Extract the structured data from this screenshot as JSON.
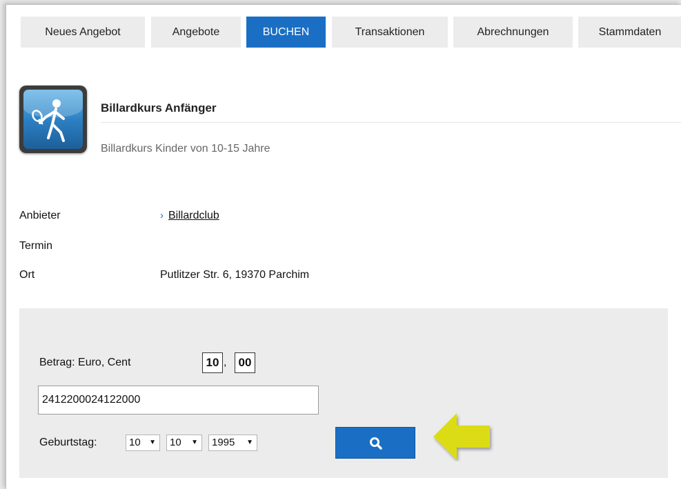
{
  "nav": {
    "tabs": [
      {
        "label": "Neues Angebot"
      },
      {
        "label": "Angebote"
      },
      {
        "label": "BUCHEN"
      },
      {
        "label": "Transaktionen"
      },
      {
        "label": "Abrechnungen"
      },
      {
        "label": "Stammdaten"
      }
    ],
    "active_tab": "BUCHEN"
  },
  "course": {
    "icon": "person-tennis-icon",
    "title": "Billardkurs Anfänger",
    "subtitle": "Billardkurs Kinder von 10-15 Jahre"
  },
  "details": {
    "anbieter_label": "Anbieter",
    "anbieter_link_icon": "chevron-right-icon",
    "anbieter_value": "Billardclub",
    "termin_label": "Termin",
    "termin_value": "",
    "ort_label": "Ort",
    "ort_value": "Putlitzer Str. 6, 19370 Parchim"
  },
  "booking": {
    "amount_label": "Betrag:  Euro, Cent",
    "euro_value": "10",
    "cent_value": "00",
    "comma": ",",
    "card_number": "2412200024122000",
    "birthday_label": "Geburtstag:",
    "day_value": "10",
    "month_value": "10",
    "year_value": "1995",
    "search_button_icon": "search-icon"
  },
  "colors": {
    "accent": "#1a6fc4",
    "panel_bg": "#ececec",
    "tab_bg": "#ececec",
    "annotation_arrow": "#dcdc14"
  }
}
